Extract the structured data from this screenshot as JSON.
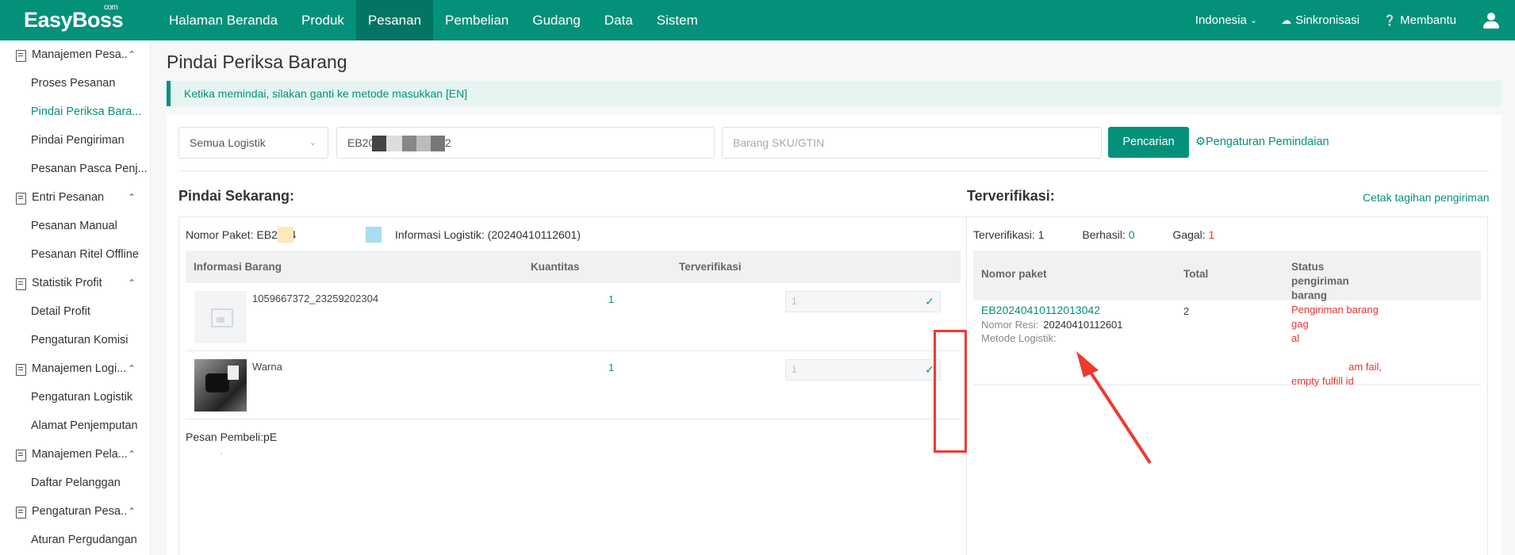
{
  "header": {
    "logo": "EasyBoss",
    "logo_suffix": "com",
    "nav": [
      "Halaman Beranda",
      "Produk",
      "Pesanan",
      "Pembelian",
      "Gudang",
      "Data",
      "Sistem"
    ],
    "active_nav": "Pesanan",
    "language": "Indonesia",
    "sync": "Sinkronisasi",
    "help": "Membantu",
    "colors": {
      "brand": "#04917a",
      "active_tab": "#037562"
    }
  },
  "sidebar": [
    {
      "group": "Manajemen Pesa...",
      "icon": "order-icon",
      "items": [
        "Proses Pesanan",
        "Pindai Periksa Bara...",
        "Pindai Pengiriman",
        "Pesanan Pasca Penj..."
      ]
    },
    {
      "group": "Entri Pesanan",
      "icon": "entry-icon",
      "items": [
        "Pesanan Manual",
        "Pesanan Ritel Offline"
      ]
    },
    {
      "group": "Statistik Profit",
      "icon": "profit-icon",
      "items": [
        "Detail Profit",
        "Pengaturan Komisi"
      ]
    },
    {
      "group": "Manajemen Logi...",
      "icon": "truck-icon",
      "items": [
        "Pengaturan Logistik",
        "Alamat Penjemputan"
      ]
    },
    {
      "group": "Manajemen Pela...",
      "icon": "customer-icon",
      "items": [
        "Daftar Pelanggan"
      ]
    },
    {
      "group": "Pengaturan Pesa...",
      "icon": "settings-icon",
      "items": [
        "Aturan Pergudangan"
      ]
    }
  ],
  "page": {
    "title": "Pindai Periksa Barang",
    "notice": "Ketika memindai, silakan ganti ke metode masukkan [EN]"
  },
  "search": {
    "logistics_select": "Semua Logistik",
    "order_value_prefix": "EB20",
    "order_value_suffix": "2",
    "sku_placeholder": "Barang SKU/GTIN",
    "search_button": "Pencarian",
    "settings_link": "Pengaturan Pemindaian"
  },
  "scan": {
    "heading": "Pindai Sekarang:",
    "package_label": "Nomor Paket: EB2024",
    "logistics_info": "Informasi Logistik: (20240410112601)",
    "columns": [
      "Informasi Barang",
      "Kuantitas",
      "Terverifikasi"
    ],
    "rows": [
      {
        "name": "1059667372_23259202304",
        "qty": "1",
        "verified": "1",
        "image": "placeholder-image-icon"
      },
      {
        "name": "Warna",
        "qty": "1",
        "verified": "1",
        "image": "product-photo"
      }
    ],
    "buyer_message": "Pesan Pembeli:pE"
  },
  "verified": {
    "heading": "Terverifikasi:",
    "print_link": "Cetak tagihan pengiriman",
    "stats": {
      "label": "Terverifikasi: 1",
      "success_label": "Berhasil: ",
      "success_value": "0",
      "fail_label": "Gagal: ",
      "fail_value": "1"
    },
    "columns": [
      "Nomor paket",
      "Total",
      "Status pengiriman barang"
    ],
    "row": {
      "package_no": "EB20240410112013042",
      "resi_label": "Nomor Resi:",
      "resi_value": "20240410112601",
      "method_label": "Metode Logistik:",
      "total": "2",
      "status_line1": "Pengiriman barang gag",
      "status_line2": "al",
      "status_line3": "am fail,",
      "status_line4": "empty fulfill id"
    }
  }
}
